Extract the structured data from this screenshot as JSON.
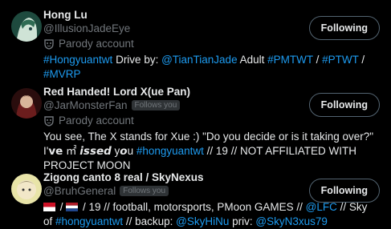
{
  "users": [
    {
      "name": "Hong Lu",
      "handle": "@IllusionJadeEye",
      "follows_you": "",
      "parody_label": "Parody account",
      "follow_label": "Following",
      "bio": [
        {
          "t": "#Hongyuantwt",
          "link": true
        },
        {
          "t": " Drive by: ",
          "link": false
        },
        {
          "t": "@TianTianJade",
          "link": true
        },
        {
          "t": " Adult ",
          "link": false
        },
        {
          "t": "#PMTWT",
          "link": true
        },
        {
          "t": " / ",
          "link": false
        },
        {
          "t": "#PTWT",
          "link": true
        },
        {
          "t": " / ",
          "link": false
        },
        {
          "t": "#MVRP",
          "link": true
        }
      ]
    },
    {
      "name": "Red Handed! Lord X(ue Pan)",
      "handle": "@JarMonsterFan",
      "follows_you": "Follows you",
      "parody_label": "Parody account",
      "follow_label": "Following",
      "bio": [
        {
          "t": "You see, The X stands for Xue :) \"Do you decide or is it taking over?\" I'𝘃𝗲 ㎡ 𝙞𝙨𝙨𝙚𝙙 y𝙤u ",
          "link": false
        },
        {
          "t": "#hongyuantwt",
          "link": true
        },
        {
          "t": " // 19 // NOT AFFILIATED WITH PROJECT MOON",
          "link": false
        }
      ]
    },
    {
      "name": "Zigong canto 8 real / SkyNexus",
      "handle": "@BruhGeneral",
      "follows_you": "Follows you",
      "parody_label": "",
      "follow_label": "Following",
      "bio": [
        {
          "t": " / ",
          "link": false
        },
        {
          "t": " / 19 // football, motorsports, PMoon GAMES // ",
          "link": false
        },
        {
          "t": "@LFC",
          "link": true
        },
        {
          "t": " // Sky of ",
          "link": false
        },
        {
          "t": "#hongyuantwt",
          "link": true
        },
        {
          "t": " // backup: ",
          "link": false
        },
        {
          "t": "@SkyHiNu",
          "link": true
        },
        {
          "t": " priv: ",
          "link": false
        },
        {
          "t": "@SkyN3xus79",
          "link": true
        }
      ]
    }
  ],
  "colors": {
    "background": "#000000",
    "text": "#e7e9ea",
    "muted": "#71767b",
    "link": "#1d9bf0",
    "button_border": "#536471"
  },
  "icons": {
    "parody": "mask-icon",
    "flags": [
      "indonesia-flag-icon",
      "netherlands-flag-icon"
    ]
  }
}
